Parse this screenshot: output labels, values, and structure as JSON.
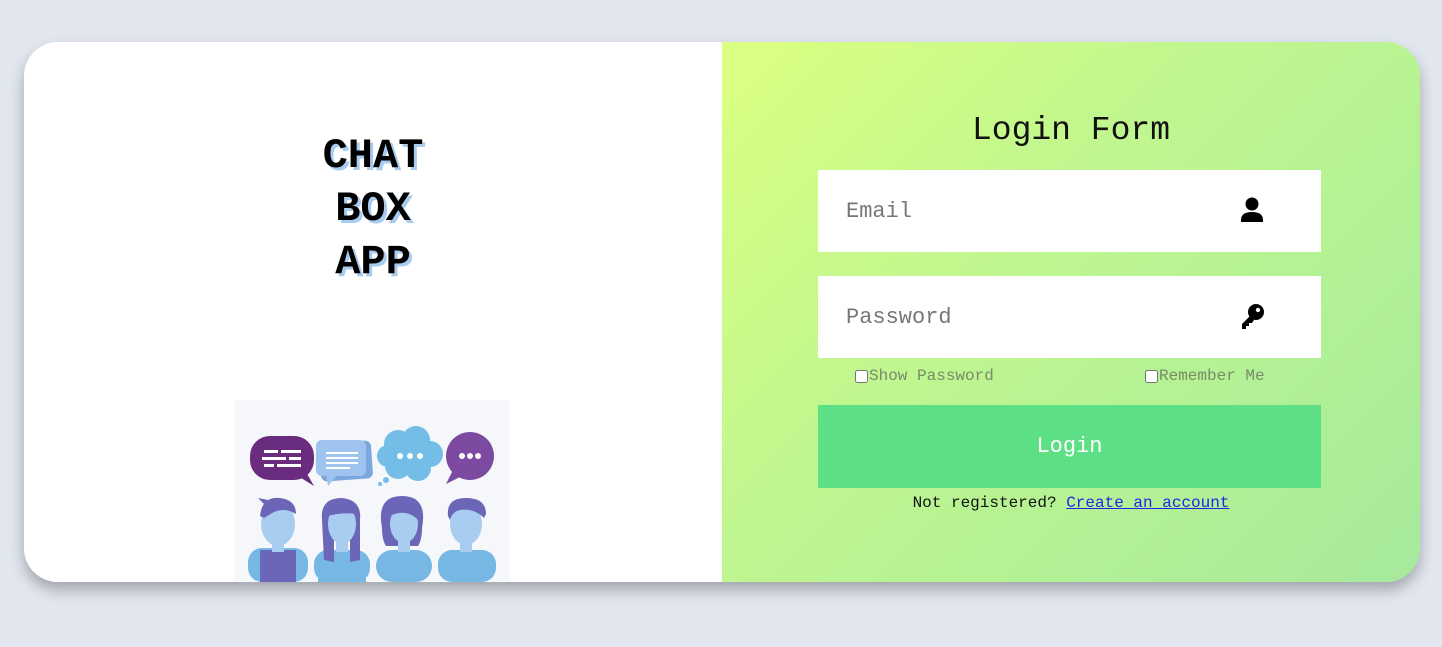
{
  "brand": {
    "line1": "CHAT",
    "line2": "BOX",
    "line3": "APP"
  },
  "login": {
    "title": "Login Form",
    "email_placeholder": "Email",
    "password_placeholder": "Password",
    "show_password_label": "Show Password",
    "remember_me_label": "Remember Me",
    "submit_label": "Login",
    "register_prompt": "Not registered?",
    "register_link": "Create an account"
  },
  "icons": {
    "email": "user-icon",
    "password": "key-icon"
  },
  "colors": {
    "page_background": "#e1e6ef",
    "button": "#5de085",
    "gradient_start": "#dcff80",
    "gradient_end": "#a6e99c",
    "brand_shadow": "#a8ccef",
    "link": "#2424e6"
  }
}
